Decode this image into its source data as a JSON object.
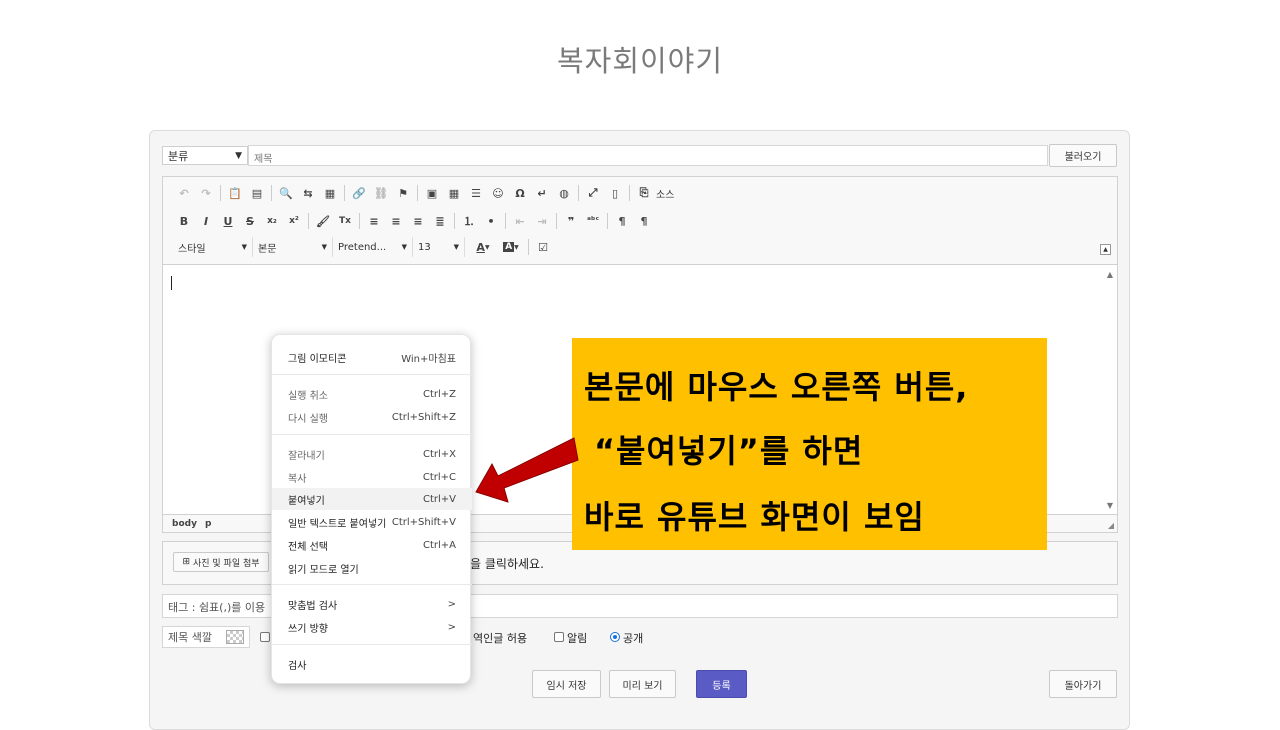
{
  "page_title": "복자회이야기",
  "form": {
    "category_select": "분류",
    "title_placeholder": "제목",
    "load_button": "불러오기"
  },
  "toolbar": {
    "row1": [
      {
        "icon": "undo-icon",
        "glyph": "↶"
      },
      {
        "icon": "redo-icon",
        "glyph": "↷"
      },
      {
        "icon": "paste-icon",
        "glyph": "📋"
      },
      {
        "icon": "paste-text-icon",
        "glyph": "▤"
      },
      {
        "icon": "find-icon",
        "glyph": "🔍"
      },
      {
        "icon": "replace-icon",
        "glyph": "⇆"
      },
      {
        "icon": "template-icon",
        "glyph": "▦"
      },
      {
        "icon": "link-icon",
        "glyph": "🔗"
      },
      {
        "icon": "unlink-icon",
        "glyph": "⛓"
      },
      {
        "icon": "anchor-flag-icon",
        "glyph": "⚑"
      },
      {
        "icon": "image-icon",
        "glyph": "▣"
      },
      {
        "icon": "table-icon",
        "glyph": "▦"
      },
      {
        "icon": "horizontal-line-icon",
        "glyph": "☰"
      },
      {
        "icon": "emoji-icon",
        "glyph": "☺"
      },
      {
        "icon": "special-char-icon",
        "glyph": "Ω"
      },
      {
        "icon": "page-break-icon",
        "glyph": "↵"
      },
      {
        "icon": "iframe-globe-icon",
        "glyph": "◍"
      },
      {
        "icon": "maximize-icon",
        "glyph": "⤢"
      },
      {
        "icon": "show-blocks-icon",
        "glyph": "▯"
      },
      {
        "icon": "source-icon",
        "glyph": "⎘"
      }
    ],
    "source_label": "소스",
    "row2": [
      {
        "icon": "bold-icon",
        "glyph": "B"
      },
      {
        "icon": "italic-icon",
        "glyph": "I"
      },
      {
        "icon": "underline-icon",
        "glyph": "U"
      },
      {
        "icon": "strike-icon",
        "glyph": "S"
      },
      {
        "icon": "subscript-icon",
        "glyph": "x₂"
      },
      {
        "icon": "superscript-icon",
        "glyph": "x²"
      },
      {
        "icon": "copy-format-icon",
        "glyph": "🖌"
      },
      {
        "icon": "remove-format-icon",
        "glyph": "Tx"
      },
      {
        "icon": "align-left-icon",
        "glyph": "≡"
      },
      {
        "icon": "align-center-icon",
        "glyph": "≡"
      },
      {
        "icon": "align-right-icon",
        "glyph": "≡"
      },
      {
        "icon": "align-justify-icon",
        "glyph": "≣"
      },
      {
        "icon": "numbered-list-icon",
        "glyph": "⒈"
      },
      {
        "icon": "bulleted-list-icon",
        "glyph": "•"
      },
      {
        "icon": "outdent-icon",
        "glyph": "⇤"
      },
      {
        "icon": "indent-icon",
        "glyph": "⇥"
      },
      {
        "icon": "blockquote-icon",
        "glyph": "❞"
      },
      {
        "icon": "spellcheck-icon",
        "glyph": "ᵃᵇᶜ"
      },
      {
        "icon": "ltr-icon",
        "glyph": "¶"
      },
      {
        "icon": "rtl-icon",
        "glyph": "¶"
      }
    ],
    "style_combo": "스타일",
    "format_combo": "본문",
    "font_combo": "Pretend...",
    "size_combo": "13",
    "text_color_label": "A",
    "bg_color_label": "A"
  },
  "statusbar": {
    "path1": "body",
    "path2": "p"
  },
  "attach": {
    "button": "사진 및 파일 첨부",
    "hint": "튼을 클릭하세요."
  },
  "tags_placeholder": "태그 : 쉼표(,)를 이용",
  "options": {
    "title_color": "제목 색깔",
    "allow_comment": "역인글 허용",
    "alarm": "알림",
    "public": "공개"
  },
  "bottom_buttons": {
    "temp_save": "임시 저장",
    "preview": "미리 보기",
    "submit": "등록",
    "back": "돌아가기",
    "submit_color": "#5a5bc4"
  },
  "context_menu": {
    "items": [
      {
        "label": "그림 이모티콘",
        "shortcut": "Win+마침표",
        "disabled": false
      },
      {
        "label": "실행 취소",
        "shortcut": "Ctrl+Z",
        "disabled": true
      },
      {
        "label": "다시 실행",
        "shortcut": "Ctrl+Shift+Z",
        "disabled": true
      },
      {
        "label": "잘라내기",
        "shortcut": "Ctrl+X",
        "disabled": true
      },
      {
        "label": "복사",
        "shortcut": "Ctrl+C",
        "disabled": true
      },
      {
        "label": "붙여넣기",
        "shortcut": "Ctrl+V",
        "disabled": false
      },
      {
        "label": "일반 텍스트로 붙여넣기",
        "shortcut": "Ctrl+Shift+V",
        "disabled": false
      },
      {
        "label": "전체 선택",
        "shortcut": "Ctrl+A",
        "disabled": false
      },
      {
        "label": "읽기 모드로 열기",
        "shortcut": "",
        "disabled": false
      },
      {
        "label": "맞춤법 검사",
        "shortcut": ">",
        "disabled": false
      },
      {
        "label": "쓰기 방향",
        "shortcut": ">",
        "disabled": false
      },
      {
        "label": "검사",
        "shortcut": "",
        "disabled": false
      }
    ]
  },
  "callout": {
    "line1": "본문에 마우스 오른쪽 버튼,",
    "line2": "“붙여넣기”를 하면",
    "line3": "바로 유튜브 화면이 보임",
    "bg_color": "#ffc000",
    "arrow_color": "#c00000"
  }
}
